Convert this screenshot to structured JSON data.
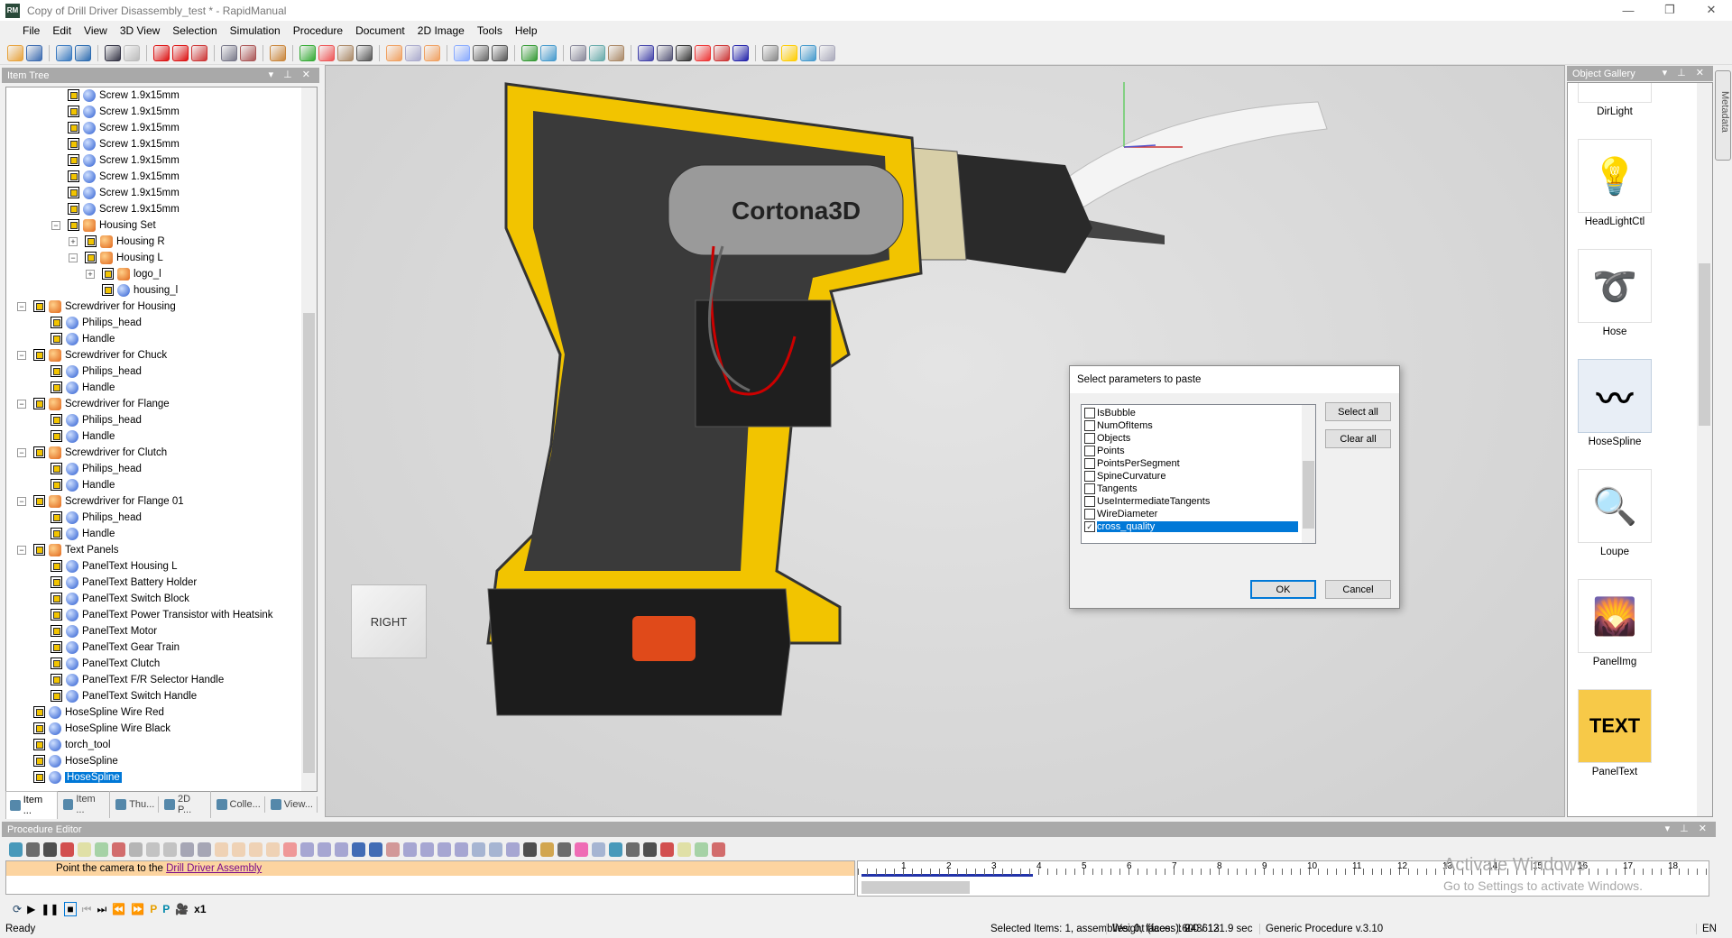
{
  "window": {
    "title": "Copy of Drill Driver Disassembly_test * - RapidManual",
    "logo": "RM"
  },
  "menu": [
    "File",
    "Edit",
    "View",
    "3D View",
    "Selection",
    "Simulation",
    "Procedure",
    "Document",
    "2D Image",
    "Tools",
    "Help"
  ],
  "item_tree": {
    "title": "Item Tree",
    "items": [
      {
        "label": "Screw 1.9x15mm",
        "level": 2,
        "kind": "part"
      },
      {
        "label": "Screw 1.9x15mm",
        "level": 2,
        "kind": "part"
      },
      {
        "label": "Screw 1.9x15mm",
        "level": 2,
        "kind": "part"
      },
      {
        "label": "Screw 1.9x15mm",
        "level": 2,
        "kind": "part"
      },
      {
        "label": "Screw 1.9x15mm",
        "level": 2,
        "kind": "part"
      },
      {
        "label": "Screw 1.9x15mm",
        "level": 2,
        "kind": "part"
      },
      {
        "label": "Screw 1.9x15mm",
        "level": 2,
        "kind": "part"
      },
      {
        "label": "Screw 1.9x15mm",
        "level": 2,
        "kind": "part"
      },
      {
        "label": "Housing Set",
        "level": 2,
        "kind": "asm",
        "exp": "-"
      },
      {
        "label": "Housing R",
        "level": 3,
        "kind": "asm",
        "exp": "+"
      },
      {
        "label": "Housing L",
        "level": 3,
        "kind": "asm",
        "exp": "-"
      },
      {
        "label": "logo_l",
        "level": 4,
        "kind": "asm",
        "exp": "+"
      },
      {
        "label": "housing_l",
        "level": 4,
        "kind": "part"
      },
      {
        "label": "Screwdriver for Housing",
        "level": 0,
        "kind": "asm",
        "exp": "-"
      },
      {
        "label": "Philips_head",
        "level": 1,
        "kind": "part"
      },
      {
        "label": "Handle",
        "level": 1,
        "kind": "part"
      },
      {
        "label": "Screwdriver for Chuck",
        "level": 0,
        "kind": "asm",
        "exp": "-"
      },
      {
        "label": "Philips_head",
        "level": 1,
        "kind": "part"
      },
      {
        "label": "Handle",
        "level": 1,
        "kind": "part"
      },
      {
        "label": "Screwdriver for Flange",
        "level": 0,
        "kind": "asm",
        "exp": "-"
      },
      {
        "label": "Philips_head",
        "level": 1,
        "kind": "part"
      },
      {
        "label": "Handle",
        "level": 1,
        "kind": "part"
      },
      {
        "label": "Screwdriver for Clutch",
        "level": 0,
        "kind": "asm",
        "exp": "-"
      },
      {
        "label": "Philips_head",
        "level": 1,
        "kind": "part"
      },
      {
        "label": "Handle",
        "level": 1,
        "kind": "part"
      },
      {
        "label": "Screwdriver for Flange 01",
        "level": 0,
        "kind": "asm",
        "exp": "-"
      },
      {
        "label": "Philips_head",
        "level": 1,
        "kind": "part"
      },
      {
        "label": "Handle",
        "level": 1,
        "kind": "part"
      },
      {
        "label": "Text Panels",
        "level": 0,
        "kind": "asm",
        "exp": "-"
      },
      {
        "label": "PanelText Housing L",
        "level": 1,
        "kind": "part"
      },
      {
        "label": "PanelText Battery Holder",
        "level": 1,
        "kind": "part"
      },
      {
        "label": "PanelText Switch Block",
        "level": 1,
        "kind": "part"
      },
      {
        "label": "PanelText Power Transistor with Heatsink",
        "level": 1,
        "kind": "part"
      },
      {
        "label": "PanelText Motor",
        "level": 1,
        "kind": "part"
      },
      {
        "label": "PanelText Gear Train",
        "level": 1,
        "kind": "part"
      },
      {
        "label": "PanelText Clutch",
        "level": 1,
        "kind": "part"
      },
      {
        "label": "PanelText F/R Selector Handle",
        "level": 1,
        "kind": "part"
      },
      {
        "label": "PanelText Switch Handle",
        "level": 1,
        "kind": "part"
      },
      {
        "label": "HoseSpline Wire Red",
        "level": 0,
        "kind": "part"
      },
      {
        "label": "HoseSpline Wire Black",
        "level": 0,
        "kind": "part"
      },
      {
        "label": "torch_tool",
        "level": 0,
        "kind": "part"
      },
      {
        "label": "HoseSpline",
        "level": 0,
        "kind": "part"
      },
      {
        "label": "HoseSpline",
        "level": 0,
        "kind": "part",
        "selected": true
      }
    ],
    "tabs": [
      "Item ...",
      "Item ...",
      "Thu...",
      "2D P...",
      "Colle...",
      "View..."
    ]
  },
  "viewport": {
    "view_cube_label": "RIGHT",
    "logo_text": "Cortona3D"
  },
  "gallery": {
    "title": "Object Gallery",
    "items": [
      "DirLight",
      "HeadLightCtl",
      "Hose",
      "HoseSpline",
      "Loupe",
      "PanelImg",
      "PanelText"
    ],
    "selected": "HoseSpline",
    "side_tab": "Metadata"
  },
  "dialog": {
    "title": "Select parameters to paste",
    "params": [
      {
        "name": "IsBubble",
        "checked": false
      },
      {
        "name": "NumOfItems",
        "checked": false
      },
      {
        "name": "Objects",
        "checked": false
      },
      {
        "name": "Points",
        "checked": false
      },
      {
        "name": "PointsPerSegment",
        "checked": false
      },
      {
        "name": "SpineCurvature",
        "checked": false
      },
      {
        "name": "Tangents",
        "checked": false
      },
      {
        "name": "UseIntermediateTangents",
        "checked": false
      },
      {
        "name": "WireDiameter",
        "checked": false
      },
      {
        "name": "cross_quality",
        "checked": true,
        "selected": true
      }
    ],
    "select_all": "Select all",
    "clear_all": "Clear all",
    "ok": "OK",
    "cancel": "Cancel"
  },
  "procedure": {
    "title": "Procedure Editor",
    "step_text": "Point the camera to the ",
    "step_link": "Drill Driver Assembly",
    "timeline_ticks": [
      "1",
      "2",
      "3",
      "4",
      "5",
      "6",
      "7",
      "8",
      "9",
      "10",
      "11",
      "12",
      "13",
      "14",
      "15",
      "16",
      "17",
      "18"
    ],
    "speed": "x1"
  },
  "watermark": {
    "line1": "Activate Windows",
    "line2": "Go to Settings to activate Windows."
  },
  "status": {
    "ready": "Ready",
    "selected": "Selected Items: 1, assemblies: 0, faces: 160",
    "weight": "Weight (faces): 243613",
    "time": "0.0 / 121.9 sec",
    "procedure": "Generic Procedure v.3.10",
    "lang": "EN"
  },
  "colors": {
    "accent": "#0078d7",
    "housing": "#f2c400",
    "step_highlight": "#fcd4a0",
    "link": "#7a0a8a"
  }
}
